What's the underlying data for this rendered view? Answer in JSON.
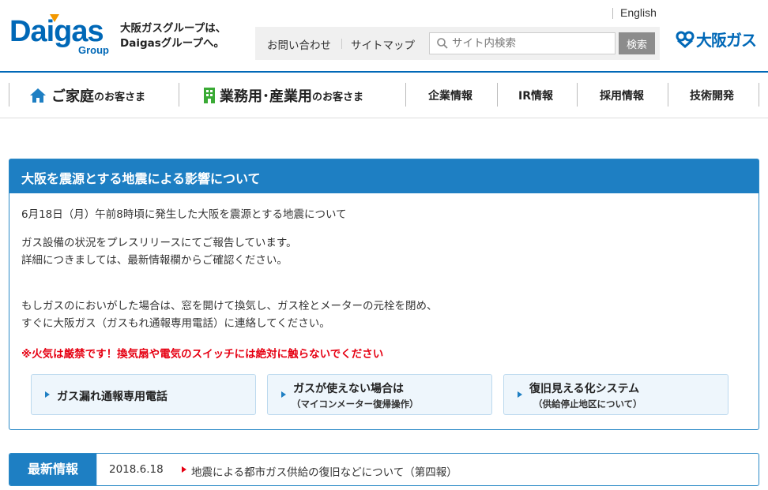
{
  "header": {
    "logo": {
      "word": "Daigas",
      "group": "Group"
    },
    "tagline": [
      "大阪ガスグループは、",
      "Daigasグループへ。"
    ],
    "english_link": "English",
    "util_links": [
      "お問い合わせ",
      "サイトマップ"
    ],
    "search": {
      "placeholder": "サイト内検索",
      "button": "検索",
      "icon": "search-icon"
    },
    "brand_logo": "大阪ガス"
  },
  "nav": {
    "home": {
      "big": "ご家庭",
      "small": "のお客さま",
      "icon": "house-icon"
    },
    "business": {
      "big": "業務用･産業用",
      "small": "のお客さま",
      "icon": "building-icon"
    },
    "items": [
      "企業情報",
      "IR情報",
      "採用情報",
      "技術開発"
    ]
  },
  "notice": {
    "title": "大阪を震源とする地震による影響について",
    "line1": "6月18日（月）午前8時頃に発生した大阪を震源とする地震について",
    "line2": "ガス設備の状況をプレスリリースにてご報告しています。",
    "line3": "詳細につきましては、最新情報欄からご確認ください。",
    "line4": "もしガスのにおいがした場合は、窓を開けて換気し、ガス栓とメーターの元栓を閉め、",
    "line5": "すぐに大阪ガス（ガスもれ通報専用電話）に連絡してください。",
    "warning": "※火気は厳禁です！換気扇や電気のスイッチには絶対に触らないでください",
    "buttons": [
      {
        "label": "ガス漏れ通報専用電話",
        "sub": ""
      },
      {
        "label": "ガスが使えない場合は",
        "sub": "（マイコンメーター復帰操作）"
      },
      {
        "label": "復旧見える化システム",
        "sub": "（供給停止地区について）"
      }
    ]
  },
  "news": {
    "label": "最新情報",
    "date": "2018.6.18",
    "title": "地震による都市ガス供給の復旧などについて（第四報）"
  },
  "colors": {
    "brand_blue": "#1e7fc3",
    "logo_blue": "#0068b7",
    "alert_red": "#e60012",
    "green": "#3aaa35"
  }
}
